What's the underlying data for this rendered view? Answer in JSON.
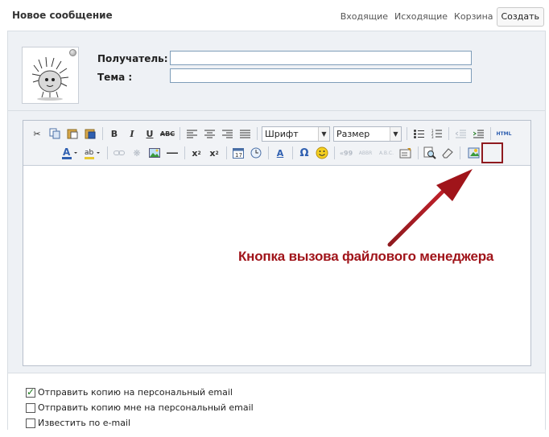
{
  "header": {
    "title": "Новое сообщение",
    "tabs": [
      "Входящие",
      "Исходящие",
      "Корзина",
      "Создать"
    ]
  },
  "form": {
    "recipient_label": "Получатель:",
    "recipient_value": "",
    "subject_label": "Тема :",
    "subject_value": ""
  },
  "toolbar": {
    "font_select": "Шрифт",
    "size_select": "Размер",
    "html_label": "HTML"
  },
  "annotation": {
    "text": "Кнопка вызова файлового менеджера",
    "color": "#a0141a"
  },
  "options": [
    {
      "label": "Отправить копию на персональный email",
      "checked": true
    },
    {
      "label": "Отправить копию мне на персональный email",
      "checked": false
    },
    {
      "label": "Известить по e-mail",
      "checked": false
    }
  ]
}
